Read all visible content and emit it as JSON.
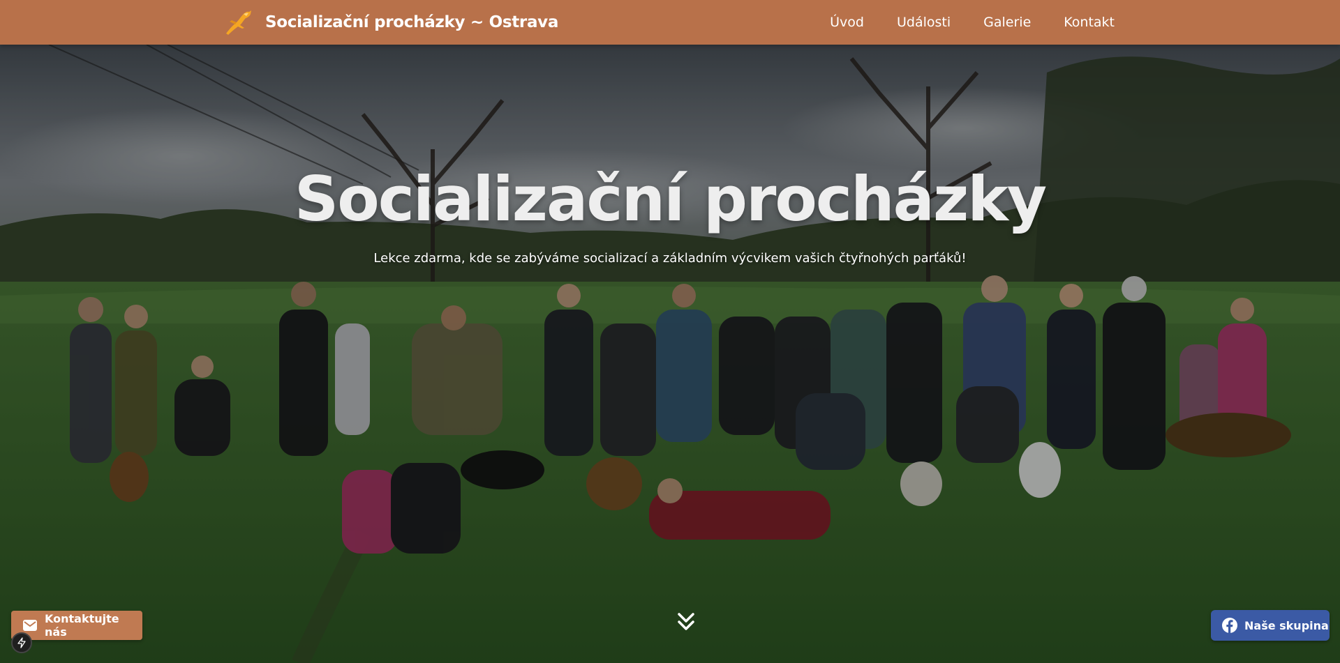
{
  "header": {
    "brand_title": "Socializační procházky ~ Ostrava",
    "logo_icon": "jumping-dog-logo",
    "nav": [
      {
        "label": "Úvod"
      },
      {
        "label": "Události"
      },
      {
        "label": "Galerie"
      },
      {
        "label": "Kontakt"
      }
    ]
  },
  "hero": {
    "title": "Socializační procházky",
    "subtitle": "Lekce zdarma, kde se zabýváme socializací a základním výcvikem vašich čtyřnohých parťáků!",
    "scroll_icon": "double-chevron-down-icon"
  },
  "floating": {
    "contact_label": "Kontaktujte nás",
    "contact_icon": "mail-icon",
    "group_label": "Naše skupina",
    "group_icon": "facebook-icon",
    "badge_icon": "lightning-icon"
  },
  "colors": {
    "header_bg": "#b8714a",
    "contact_bg": "#c07a52",
    "group_bg": "#3b5aa5"
  }
}
